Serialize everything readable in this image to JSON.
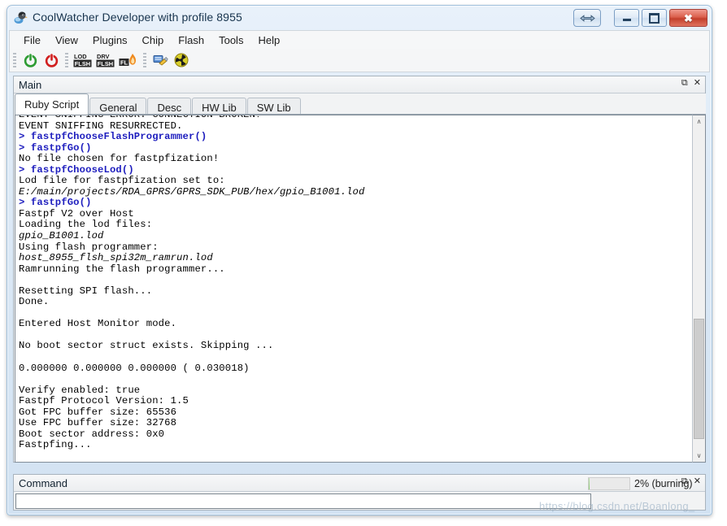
{
  "window": {
    "title": "CoolWatcher Developer with profile 8955",
    "app_icon": "coolwatcher-app-icon",
    "buttons": {
      "resize": "resize-arrows-icon",
      "minimize": "—",
      "maximize": "□",
      "close": "✖"
    }
  },
  "menubar": {
    "items": [
      {
        "label": "File"
      },
      {
        "label": "View"
      },
      {
        "label": "Plugins"
      },
      {
        "label": "Chip"
      },
      {
        "label": "Flash"
      },
      {
        "label": "Tools"
      },
      {
        "label": "Help"
      }
    ]
  },
  "toolbar": {
    "groups": [
      {
        "buttons": [
          {
            "name": "power-on-icon",
            "label": ""
          },
          {
            "name": "power-off-icon",
            "label": ""
          }
        ]
      },
      {
        "buttons": [
          {
            "name": "lod-flsh-icon",
            "label": "LOD FLSH"
          },
          {
            "name": "drv-flsh-icon",
            "label": "DRV FLSH"
          },
          {
            "name": "fl-burn-icon",
            "label": "FL"
          }
        ]
      },
      {
        "buttons": [
          {
            "name": "broom-clean-icon",
            "label": ""
          },
          {
            "name": "radiation-icon",
            "label": ""
          }
        ]
      }
    ]
  },
  "panels": {
    "main": {
      "caption": "Main",
      "float_icon": "⧉",
      "close_icon": "✕",
      "tabs": [
        {
          "label": "Ruby Script",
          "active": true
        },
        {
          "label": "General",
          "active": false
        },
        {
          "label": "Desc",
          "active": false
        },
        {
          "label": "HW Lib",
          "active": false
        },
        {
          "label": "SW Lib",
          "active": false
        }
      ],
      "console_lines": [
        {
          "text": "EVENT SNIFFING ERROR: CONNECTION BROKEN?",
          "style": "out"
        },
        {
          "text": "EVENT SNIFFING RESURRECTED.",
          "style": "out"
        },
        {
          "text": "> fastpfChooseFlashProgrammer()",
          "style": "cmd"
        },
        {
          "text": "> fastpfGo()",
          "style": "cmd"
        },
        {
          "text": "No file chosen for fastpfization!",
          "style": "out"
        },
        {
          "text": "> fastpfChooseLod()",
          "style": "cmd"
        },
        {
          "text": "Lod file for fastpfization set to:",
          "style": "out"
        },
        {
          "text": "E:/main/projects/RDA_GPRS/GPRS_SDK_PUB/hex/gpio_B1001.lod",
          "style": "path"
        },
        {
          "text": "> fastpfGo()",
          "style": "cmd"
        },
        {
          "text": "Fastpf V2 over Host",
          "style": "out"
        },
        {
          "text": "Loading the lod files:",
          "style": "out"
        },
        {
          "text": "gpio_B1001.lod",
          "style": "path"
        },
        {
          "text": "Using flash programmer:",
          "style": "out"
        },
        {
          "text": "host_8955_flsh_spi32m_ramrun.lod",
          "style": "path"
        },
        {
          "text": "Ramrunning the flash programmer...",
          "style": "out"
        },
        {
          "text": "",
          "style": "blank"
        },
        {
          "text": "Resetting SPI flash...",
          "style": "out"
        },
        {
          "text": "Done.",
          "style": "out"
        },
        {
          "text": "",
          "style": "blank"
        },
        {
          "text": "Entered Host Monitor mode.",
          "style": "out"
        },
        {
          "text": "",
          "style": "blank"
        },
        {
          "text": "No boot sector struct exists. Skipping ...",
          "style": "out"
        },
        {
          "text": "",
          "style": "blank"
        },
        {
          "text": "0.000000 0.000000 0.000000 ( 0.030018)",
          "style": "out"
        },
        {
          "text": "",
          "style": "blank"
        },
        {
          "text": "Verify enabled: true",
          "style": "out"
        },
        {
          "text": "Fastpf Protocol Version: 1.5",
          "style": "out"
        },
        {
          "text": "Got FPC buffer size: 65536",
          "style": "out"
        },
        {
          "text": "Use FPC buffer size: 32768",
          "style": "out"
        },
        {
          "text": "Boot sector address: 0x0",
          "style": "out"
        },
        {
          "text": "Fastpfing...",
          "style": "out"
        }
      ],
      "scrollbar": {
        "up_arrow": "∧",
        "down_arrow": "∨"
      }
    },
    "command": {
      "caption": "Command",
      "float_icon": "⧉",
      "close_icon": "✕",
      "input_value": "",
      "input_placeholder": ""
    }
  },
  "statusbar": {
    "progress_percent": 2,
    "progress_label": "2% (burning)"
  },
  "watermark": {
    "text": "https://blog.csdn.net/Boanlong_"
  },
  "colors": {
    "command_text": "#1d1dbe",
    "output_text": "#000000",
    "accent": "#9fc0dc",
    "close_button": "#c33f2c",
    "progress_fill": "#88c96f"
  }
}
